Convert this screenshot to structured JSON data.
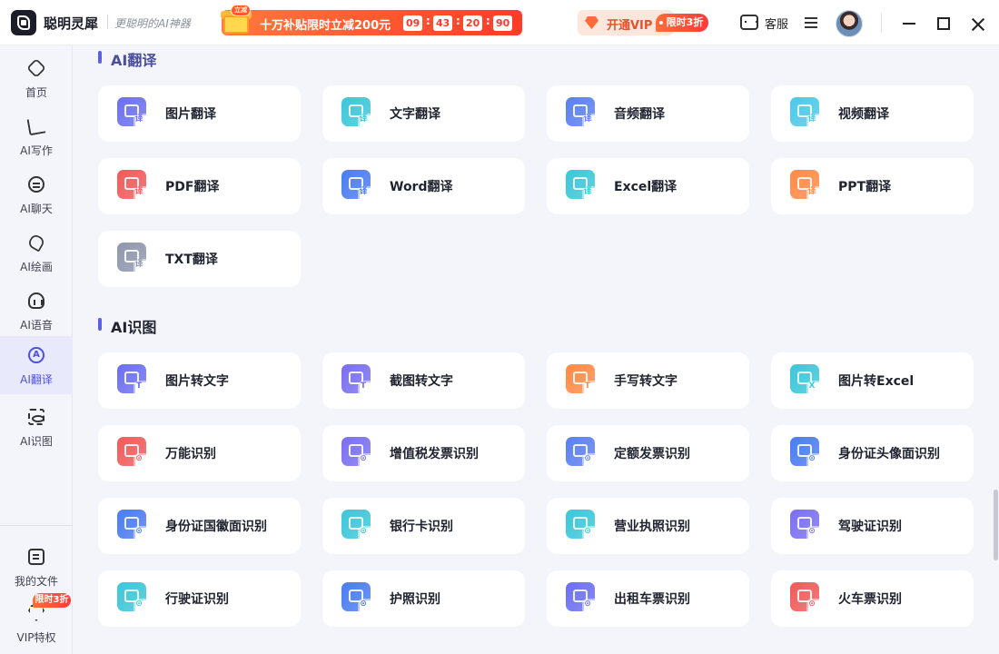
{
  "app": {
    "name": "聪明灵犀",
    "slogan": "更聪明的AI神器"
  },
  "promo": {
    "gift_badge": "立减",
    "text": "十万补贴限时立减200元",
    "countdown": [
      "09",
      "43",
      "20",
      "90"
    ],
    "separator": ":"
  },
  "vip": {
    "label": "开通VIP",
    "badge": "限时3折"
  },
  "header": {
    "service_label": "客服"
  },
  "sidebar": {
    "items": [
      {
        "label": "首页",
        "icon": "home-icon",
        "active": false
      },
      {
        "label": "AI写作",
        "icon": "pen-icon",
        "active": false
      },
      {
        "label": "AI聊天",
        "icon": "chat-icon",
        "active": false
      },
      {
        "label": "AI绘画",
        "icon": "brush-icon",
        "active": false
      },
      {
        "label": "AI语音",
        "icon": "voice-icon",
        "active": false
      },
      {
        "label": "AI翻译",
        "icon": "translate-icon",
        "active": true
      },
      {
        "label": "AI识图",
        "icon": "scan-icon",
        "active": false
      }
    ],
    "bottom": [
      {
        "label": "我的文件",
        "icon": "file-icon"
      },
      {
        "label": "VIP特权",
        "icon": "vip-icon"
      }
    ],
    "bottom_badge": "限时3折"
  },
  "sections": [
    {
      "title": "AI翻译",
      "items": [
        {
          "label": "图片翻译",
          "color": "#6b6ff0",
          "badge": "译"
        },
        {
          "label": "文字翻译",
          "color": "#3cc6d8",
          "badge": "译"
        },
        {
          "label": "音频翻译",
          "color": "#5b7ff0",
          "badge": "译"
        },
        {
          "label": "视频翻译",
          "color": "#4cc8e8",
          "badge": "译"
        },
        {
          "label": "PDF翻译",
          "color": "#f05a5a",
          "badge": "译"
        },
        {
          "label": "Word翻译",
          "color": "#4a7cf0",
          "badge": "译"
        },
        {
          "label": "Excel翻译",
          "color": "#3cc6d8",
          "badge": "译"
        },
        {
          "label": "PPT翻译",
          "color": "#ff8a45",
          "badge": "译"
        },
        {
          "label": "TXT翻译",
          "color": "#8f97ad",
          "badge": "译"
        }
      ]
    },
    {
      "title": "AI识图",
      "items": [
        {
          "label": "图片转文字",
          "color": "#6b6ff0",
          "badge": "T"
        },
        {
          "label": "截图转文字",
          "color": "#7a6ff0",
          "badge": "T"
        },
        {
          "label": "手写转文字",
          "color": "#ff8a45",
          "badge": "T"
        },
        {
          "label": "图片转Excel",
          "color": "#3cc6d8",
          "badge": "X"
        },
        {
          "label": "万能识别",
          "color": "#f05a5a",
          "badge": "⊙"
        },
        {
          "label": "增值税发票识别",
          "color": "#7a6ff0",
          "badge": "⊙"
        },
        {
          "label": "定额发票识别",
          "color": "#5b7ff0",
          "badge": "⊙"
        },
        {
          "label": "身份证头像面识别",
          "color": "#4a7cf0",
          "badge": "⊙"
        },
        {
          "label": "身份证国徽面识别",
          "color": "#4a7cf0",
          "badge": "⊙"
        },
        {
          "label": "银行卡识别",
          "color": "#3cc6d8",
          "badge": "⊙"
        },
        {
          "label": "营业执照识别",
          "color": "#3cc6d8",
          "badge": "⊙"
        },
        {
          "label": "驾驶证识别",
          "color": "#7a6ff0",
          "badge": "⊙"
        },
        {
          "label": "行驶证识别",
          "color": "#3cc6d8",
          "badge": "⊙"
        },
        {
          "label": "护照识别",
          "color": "#4a7cf0",
          "badge": "⊙"
        },
        {
          "label": "出租车票识别",
          "color": "#6b6ff0",
          "badge": "⊙"
        },
        {
          "label": "火车票识别",
          "color": "#f05a5a",
          "badge": "⊙"
        }
      ]
    }
  ]
}
